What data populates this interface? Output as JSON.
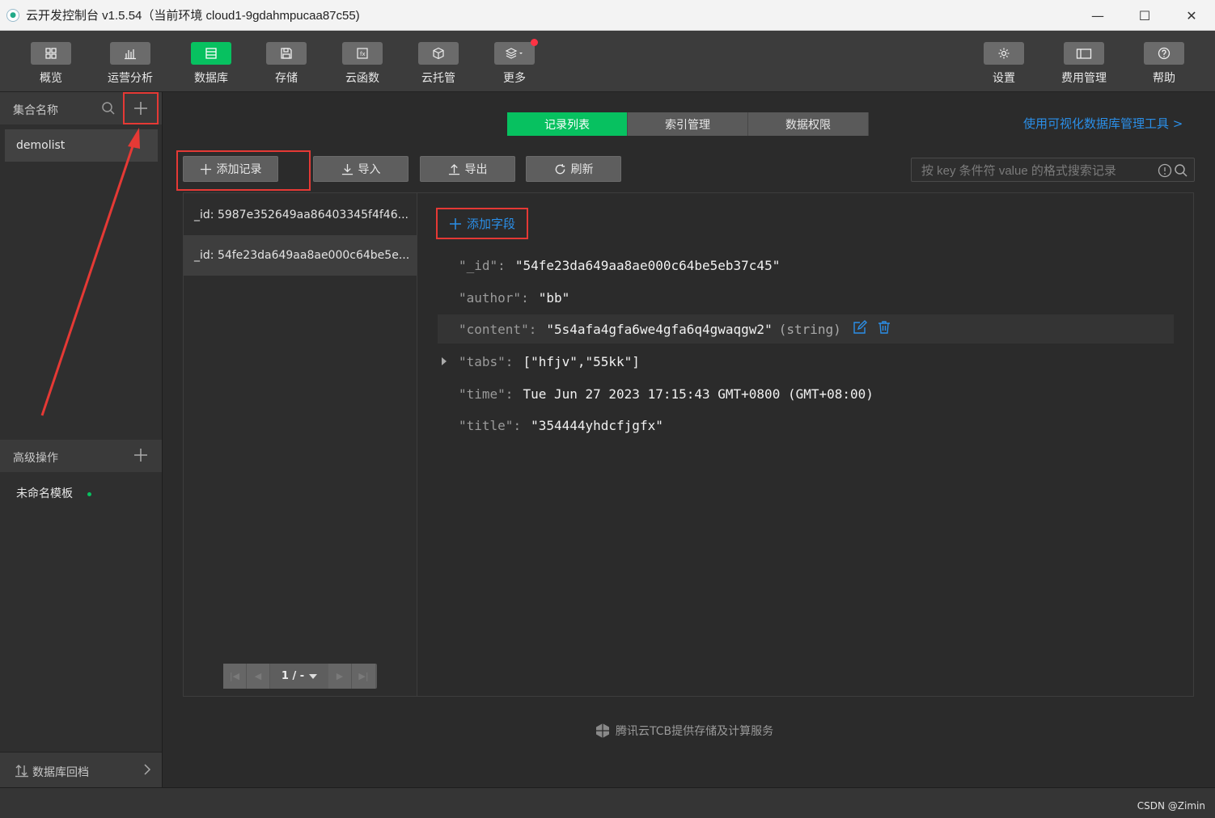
{
  "window": {
    "title": "云开发控制台 v1.5.54（当前环境 cloud1-9gdahmpucaa87c55)",
    "minimize": "—",
    "maximize": "☐",
    "close": "✕"
  },
  "toolbar": {
    "items": [
      {
        "label": "概览",
        "icon": "grid-icon"
      },
      {
        "label": "运营分析",
        "icon": "bar-chart-icon"
      },
      {
        "label": "数据库",
        "icon": "database-icon",
        "active": true
      },
      {
        "label": "存储",
        "icon": "save-icon"
      },
      {
        "label": "云函数",
        "icon": "function-icon"
      },
      {
        "label": "云托管",
        "icon": "cube-icon"
      },
      {
        "label": "更多",
        "icon": "layers-icon",
        "badge": true
      }
    ],
    "right_items": [
      {
        "label": "设置",
        "icon": "gear-icon"
      },
      {
        "label": "费用管理",
        "icon": "wallet-icon"
      },
      {
        "label": "帮助",
        "icon": "help-icon"
      }
    ]
  },
  "sidebar": {
    "collections_header": "集合名称",
    "collections": [
      "demolist"
    ],
    "advanced_header": "高级操作",
    "templates": [
      "未命名模板"
    ],
    "backup_label": "数据库回档"
  },
  "main": {
    "tabs": [
      {
        "label": "记录列表",
        "active": true
      },
      {
        "label": "索引管理"
      },
      {
        "label": "数据权限"
      }
    ],
    "visual_tool_link": "使用可视化数据库管理工具 >",
    "buttons": {
      "add_record": "添加记录",
      "import": "导入",
      "export": "导出",
      "refresh": "刷新"
    },
    "search_placeholder": "按 key 条件符 value 的格式搜索记录",
    "records": [
      "_id: 5987e352649aa86403345f4f46...",
      "_id: 54fe23da649aa8ae000c64be5e..."
    ],
    "pager": {
      "value": "1 / -"
    },
    "add_field": "添加字段",
    "fields": [
      {
        "key": "\"_id\"",
        "colon": ":",
        "value": "\"54fe23da649aa8ae000c64be5eb37c45\""
      },
      {
        "key": "\"author\"",
        "colon": ":",
        "value": "\"bb\""
      },
      {
        "key": "\"content\"",
        "colon": ":",
        "value": "\"5s4afa4gfa6we4gfa6q4gwaqgw2\"",
        "type": "(string)"
      },
      {
        "key": "\"tabs\"",
        "colon": ":",
        "value": "[\"hfjv\",\"55kk\"]"
      },
      {
        "key": "\"time\"",
        "colon": ":",
        "value": "Tue Jun 27 2023 17:15:43 GMT+0800 (GMT+08:00)"
      },
      {
        "key": "\"title\"",
        "colon": ":",
        "value": "\"354444yhdcfjgfx\""
      }
    ],
    "footer_note": "腾讯云TCB提供存储及计算服务"
  },
  "statusbar": {
    "watermark": "CSDN @Zimin"
  },
  "colors": {
    "accent": "#07c160",
    "link": "#2b8fe8",
    "highlight": "#e53935"
  }
}
